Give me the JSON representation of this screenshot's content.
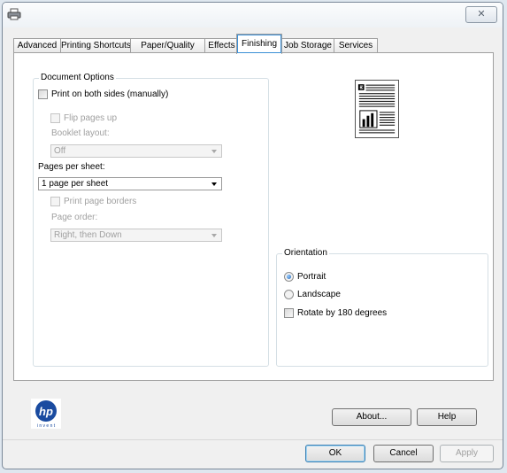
{
  "window": {
    "close_symbol": "✕"
  },
  "tabs": [
    {
      "label": "Advanced"
    },
    {
      "label": "Printing Shortcuts"
    },
    {
      "label": "Paper/Quality"
    },
    {
      "label": "Effects"
    },
    {
      "label": "Finishing"
    },
    {
      "label": "Job Storage"
    },
    {
      "label": "Services"
    }
  ],
  "active_tab": "Finishing",
  "document_options": {
    "legend": "Document Options",
    "print_both_sides": {
      "label": "Print on both sides (manually)",
      "checked": false
    },
    "flip_pages_up": {
      "label": "Flip pages up",
      "checked": false,
      "enabled": false
    },
    "booklet_layout": {
      "label": "Booklet layout:",
      "value": "Off",
      "enabled": false
    },
    "pages_per_sheet": {
      "label": "Pages per sheet:",
      "value": "1 page per sheet"
    },
    "print_page_borders": {
      "label": "Print page borders",
      "checked": false,
      "enabled": false
    },
    "page_order": {
      "label": "Page order:",
      "value": "Right, then Down",
      "enabled": false
    }
  },
  "orientation": {
    "legend": "Orientation",
    "portrait": {
      "label": "Portrait",
      "selected": true
    },
    "landscape": {
      "label": "Landscape",
      "selected": false
    },
    "rotate_180": {
      "label": "Rotate by 180 degrees",
      "checked": false
    }
  },
  "buttons": {
    "about": "About...",
    "help": "Help",
    "ok": "OK",
    "cancel": "Cancel",
    "apply": "Apply"
  },
  "logo": {
    "brand": "hp",
    "tagline": "i n v e n t",
    "color": "#1a4ba0"
  }
}
